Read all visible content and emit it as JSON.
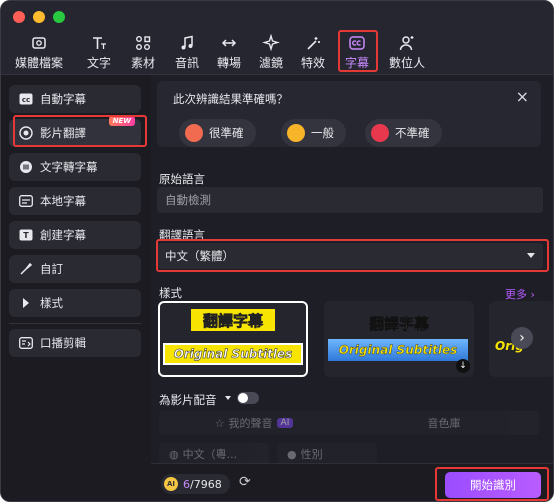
{
  "toolbar": {
    "items": [
      {
        "label": "媒體檔案",
        "icon": "cloud-folder-icon"
      },
      {
        "label": "文字",
        "icon": "text-icon"
      },
      {
        "label": "素材",
        "icon": "elements-icon"
      },
      {
        "label": "音訊",
        "icon": "music-note-icon"
      },
      {
        "label": "轉場",
        "icon": "transition-arrows-icon"
      },
      {
        "label": "濾鏡",
        "icon": "sparkle-icon"
      },
      {
        "label": "特效",
        "icon": "effects-wand-icon"
      },
      {
        "label": "字幕",
        "icon": "captions-icon"
      },
      {
        "label": "數位人",
        "icon": "digital-human-icon"
      }
    ],
    "active": "字幕"
  },
  "sidebar": {
    "items": [
      {
        "label": "自動字幕",
        "icon": "cc-icon"
      },
      {
        "label": "影片翻譯",
        "icon": "translate-icon",
        "badge": "NEW"
      },
      {
        "label": "文字轉字幕",
        "icon": "text-to-caption-icon"
      },
      {
        "label": "本地字幕",
        "icon": "local-subtitle-icon"
      },
      {
        "label": "創建字幕",
        "icon": "create-subtitle-icon"
      },
      {
        "label": "自訂",
        "icon": "brush-icon"
      },
      {
        "label": "樣式",
        "icon": "triangle-right-icon"
      },
      {
        "label": "口播剪輯",
        "icon": "speech-edit-icon"
      }
    ]
  },
  "feedback": {
    "question": "此次辨識結果準確嗎？",
    "options": [
      "很準確",
      "一般",
      "不準確"
    ]
  },
  "source_language": {
    "label": "原始語言",
    "value": "自動檢測"
  },
  "target_language": {
    "label": "翻譯語言",
    "value": "中文（繁體）"
  },
  "styles": {
    "label": "樣式",
    "more": "更多",
    "card1_top": "翻譯字幕",
    "card1_bottom": "Original Subtitles",
    "card2_top": "翻譯字幕",
    "card2_bottom": "Original Subtitles",
    "card3_partial": "Orig"
  },
  "dubbing": {
    "label": "為影片配音",
    "tab_voice": "我的聲音",
    "tab_voice_badge": "AI",
    "tab_library": "音色庫",
    "lang_select": "中文（粵...",
    "gender_select": "性別"
  },
  "footer": {
    "credits": "6",
    "credits_total": "/7968",
    "start_button": "開始識別"
  },
  "colors": {
    "accent": "#b85cff",
    "highlight": "#e53935"
  }
}
